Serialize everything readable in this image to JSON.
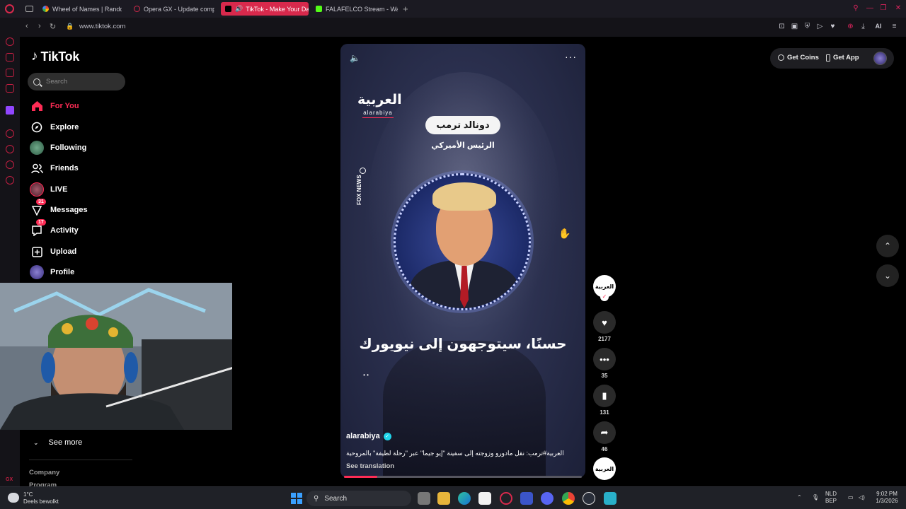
{
  "browser": {
    "tabs": [
      {
        "label": "Wheel of Names | Random",
        "active": false
      },
      {
        "label": "Opera GX - Update comp",
        "active": false
      },
      {
        "label": "TikTok - Make Your Da",
        "active": true
      },
      {
        "label": "FALAFELCO Stream - Wat",
        "active": false
      }
    ],
    "url": "www.tiktok.com",
    "toolbar_ai": "AI"
  },
  "tiktok": {
    "logo": "TikTok",
    "search_placeholder": "Search",
    "nav": [
      {
        "label": "For You",
        "icon": "home-icon"
      },
      {
        "label": "Explore",
        "icon": "compass-icon"
      },
      {
        "label": "Following",
        "icon": "following-avatar"
      },
      {
        "label": "Friends",
        "icon": "friends-icon"
      },
      {
        "label": "LIVE",
        "icon": "live-avatar"
      },
      {
        "label": "Messages",
        "icon": "messages-icon",
        "badge": "31"
      },
      {
        "label": "Activity",
        "icon": "activity-icon",
        "badge": "17"
      },
      {
        "label": "Upload",
        "icon": "upload-icon"
      },
      {
        "label": "Profile",
        "icon": "profile-avatar"
      }
    ],
    "see_more": "See more",
    "footer": [
      "Company",
      "Program"
    ],
    "top_right": {
      "coins": "Get Coins",
      "app": "Get App"
    }
  },
  "video": {
    "channel_logo_text": "العربية",
    "channel_logo_sub": "alarabiya",
    "fox_news": "FOX NEWS",
    "name_pill": "دونالد ترمب",
    "subtitle": "الرئيس الأميركي",
    "caption_big": "حسنًا، سيتوجهون إلى نيويورك",
    "dots": "• •",
    "author": "alarabiya",
    "description": "العربية#ترمب: نقل مادورو وزوجته إلى سفينة \"إيو جيما\" عبر \"رحلة لطيفة\" بالمروحية",
    "see_translation": "See translation",
    "progress": 0.14
  },
  "actions": {
    "likes": "2177",
    "comments": "35",
    "saves": "131",
    "shares": "46",
    "avatar_text": "العربية"
  },
  "taskbar": {
    "weather_temp": "1°C",
    "weather_desc": "Deels bewolkt",
    "search": "Search",
    "lang_top": "NLD",
    "lang_bottom": "BEP",
    "time": "9:02 PM",
    "date": "1/3/2026"
  },
  "colors": {
    "accent": "#fe2c55",
    "opera": "#d8294c"
  }
}
